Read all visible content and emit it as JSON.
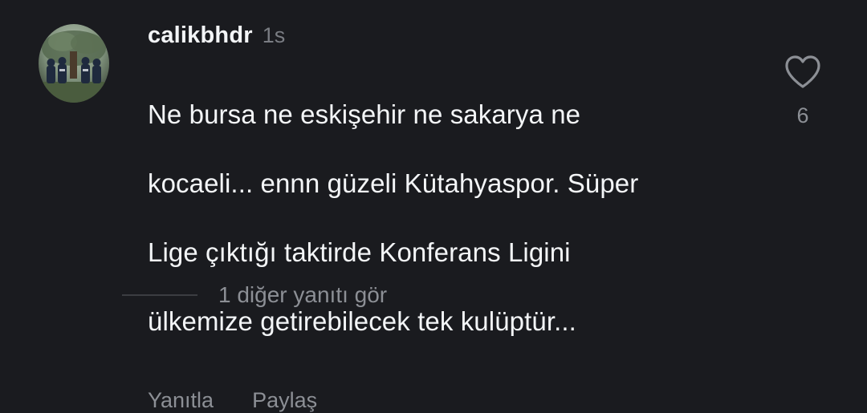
{
  "comment": {
    "username": "calikbhdr",
    "timestamp": "1s",
    "text_lines": [
      "Ne bursa ne eskişehir ne sakarya ne",
      "kocaeli... ennn güzeli Kütahyaspor. Süper",
      "Lige çıktığı taktirde Konferans Ligini",
      "ülkemize getirebilecek tek kulüptür..."
    ],
    "like_count": "6",
    "like_icon": "heart-outline-icon",
    "avatar_icon": "avatar-image"
  },
  "actions": {
    "reply_label": "Yanıtla",
    "share_label": "Paylaş"
  },
  "replies": {
    "more_label": "1 diğer yanıtı gör"
  },
  "colors": {
    "background": "#1a1b1f",
    "primary_text": "#f3f5f7",
    "secondary_text": "#8c8f95"
  }
}
